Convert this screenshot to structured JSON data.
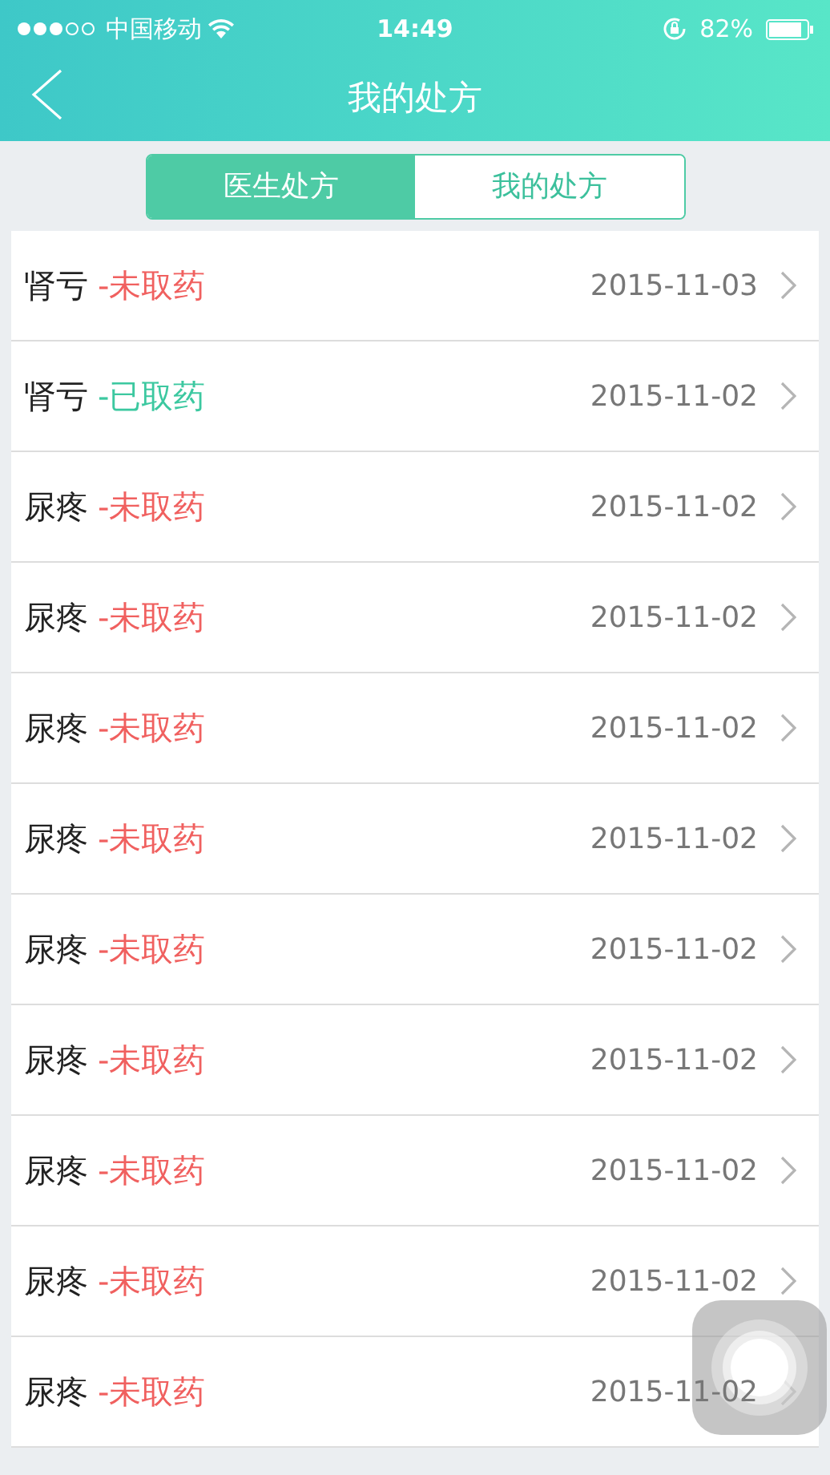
{
  "status_bar": {
    "carrier": "中国移动",
    "time": "14:49",
    "battery": "82%"
  },
  "nav": {
    "title": "我的处方"
  },
  "tabs": [
    {
      "label": "医生处方",
      "selected": true
    },
    {
      "label": "我的处方",
      "selected": false
    }
  ],
  "prescriptions": [
    {
      "name": "肾亏",
      "status": "-未取药",
      "kind": "pending",
      "date": "2015-11-03"
    },
    {
      "name": "肾亏",
      "status": "-已取药",
      "kind": "taken",
      "date": "2015-11-02"
    },
    {
      "name": "尿疼",
      "status": "-未取药",
      "kind": "pending",
      "date": "2015-11-02"
    },
    {
      "name": "尿疼",
      "status": "-未取药",
      "kind": "pending",
      "date": "2015-11-02"
    },
    {
      "name": "尿疼",
      "status": "-未取药",
      "kind": "pending",
      "date": "2015-11-02"
    },
    {
      "name": "尿疼",
      "status": "-未取药",
      "kind": "pending",
      "date": "2015-11-02"
    },
    {
      "name": "尿疼",
      "status": "-未取药",
      "kind": "pending",
      "date": "2015-11-02"
    },
    {
      "name": "尿疼",
      "status": "-未取药",
      "kind": "pending",
      "date": "2015-11-02"
    },
    {
      "name": "尿疼",
      "status": "-未取药",
      "kind": "pending",
      "date": "2015-11-02"
    },
    {
      "name": "尿疼",
      "status": "-未取药",
      "kind": "pending",
      "date": "2015-11-02"
    },
    {
      "name": "尿疼",
      "status": "-未取药",
      "kind": "pending",
      "date": "2015-11-02"
    }
  ]
}
